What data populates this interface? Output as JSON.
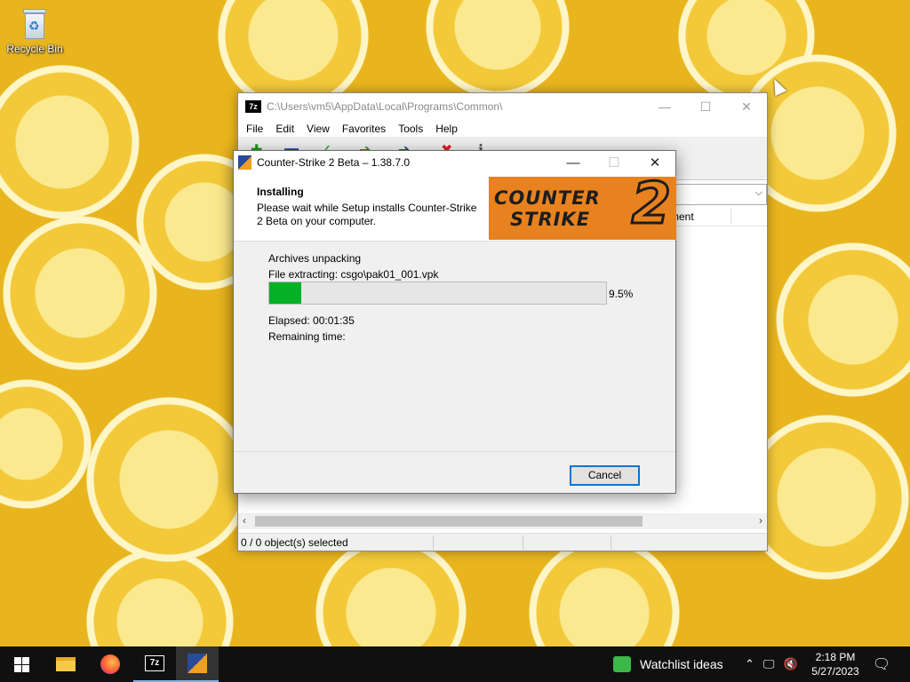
{
  "desktop": {
    "recycle_bin_label": "Recycle Bin"
  },
  "zip_window": {
    "title": "C:\\Users\\vm5\\AppData\\Local\\Programs\\Common\\",
    "logo": "7z",
    "controls": {
      "minimize": "—",
      "maximize": "☐",
      "close": "✕"
    },
    "menu": [
      "File",
      "Edit",
      "View",
      "Favorites",
      "Tools",
      "Help"
    ],
    "column_header": "ment",
    "status": "0 / 0 object(s) selected"
  },
  "setup_dialog": {
    "title": "Counter-Strike 2 Beta – 1.38.7.0",
    "controls": {
      "minimize": "—",
      "maximize": "☐",
      "close": "✕"
    },
    "header_title": "Installing",
    "header_subtitle": "Please wait while Setup installs Counter-Strike 2 Beta on your computer.",
    "banner": {
      "line1": "COUNTER",
      "line2": "STRIKE",
      "number": "2"
    },
    "status_line": "Archives unpacking",
    "file_line": "File extracting: csgo\\pak01_001.vpk",
    "progress_fraction": 0.095,
    "progress_label": "9.5%",
    "elapsed": "Elapsed:  00:01:35",
    "remaining": "Remaining time:",
    "cancel_label": "Cancel"
  },
  "taskbar": {
    "apps": [
      "start",
      "file-explorer",
      "firefox",
      "7-zip",
      "counter-strike-2-setup"
    ],
    "news_label": "Watchlist ideas",
    "clock_time": "2:18 PM",
    "clock_date": "5/27/2023"
  },
  "colors": {
    "progress_fill": "#06b025",
    "accent_blue": "#0078d7",
    "banner_orange": "#e8821f",
    "taskbar": "#101010"
  }
}
